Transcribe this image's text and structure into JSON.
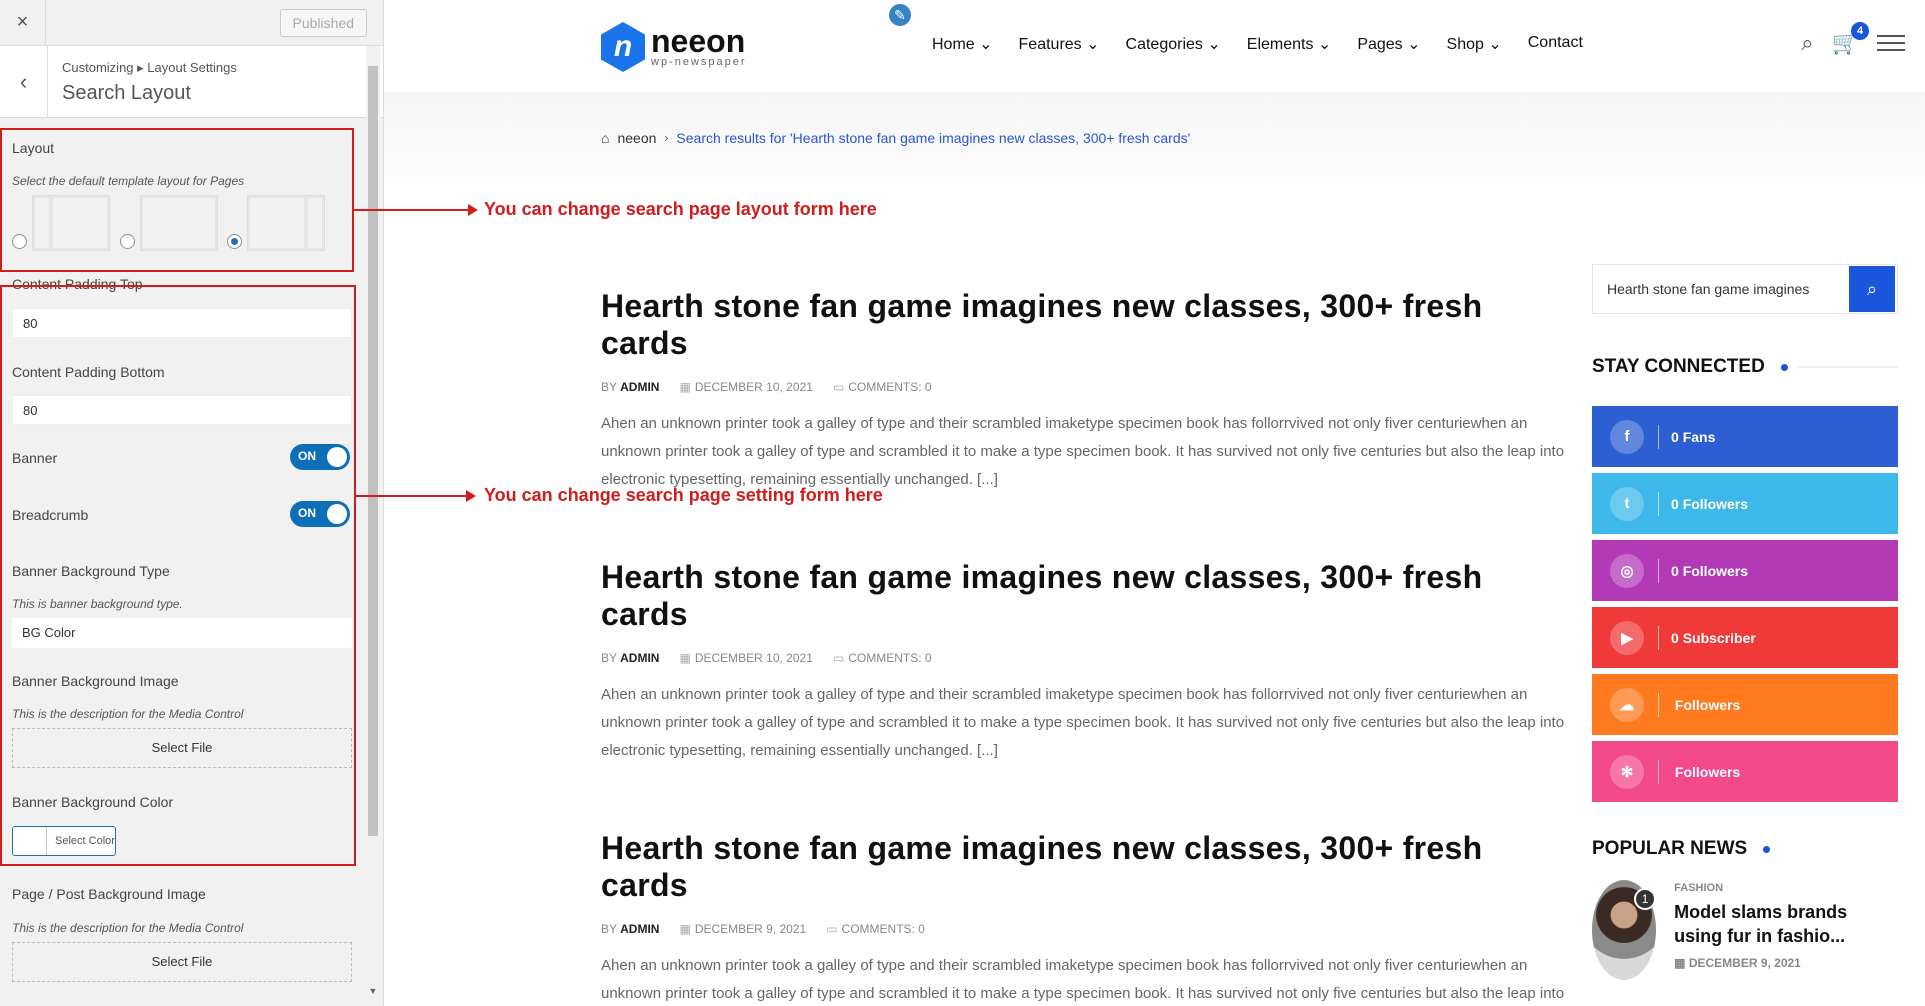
{
  "customizer": {
    "close_icon": "×",
    "published_label": "Published",
    "breadcrumb": "Customizing ▸ Layout Settings",
    "title": "Search Layout",
    "layout": {
      "label": "Layout",
      "description": "Select the default template layout for Pages",
      "selected": 3
    },
    "padding_top": {
      "label": "Content Padding Top",
      "value": "80"
    },
    "padding_bottom": {
      "label": "Content Padding Bottom",
      "value": "80"
    },
    "banner": {
      "label": "Banner",
      "toggle": "ON"
    },
    "breadcrumb_setting": {
      "label": "Breadcrumb",
      "toggle": "ON"
    },
    "banner_bg_type": {
      "label": "Banner Background Type",
      "description": "This is banner background type.",
      "value": "BG Color"
    },
    "banner_bg_image": {
      "label": "Banner Background Image",
      "description": "This is the description for the Media Control",
      "button": "Select File"
    },
    "banner_bg_color": {
      "label": "Banner Background Color",
      "button": "Select Color"
    },
    "page_bg_image": {
      "label": "Page / Post Background Image",
      "description": "This is the description for the Media Control",
      "button": "Select File"
    }
  },
  "annotations": {
    "layout_note": "You can change search page layout form here",
    "setting_note": "You can change search page setting form here"
  },
  "header": {
    "logo_name": "neeon",
    "logo_sub": "wp-newspaper",
    "nav": [
      "Home ⌄",
      "Features ⌄",
      "Categories ⌄",
      "Elements ⌄",
      "Pages ⌄",
      "Shop ⌄",
      "Contact"
    ],
    "cart_count": "4"
  },
  "breadcrumb": {
    "home": "neeon",
    "current": "Search results for 'Hearth stone fan game imagines new classes, 300+ fresh cards'"
  },
  "posts": [
    {
      "title": "Hearth stone fan game imagines new classes, 300+ fresh cards",
      "by": "BY",
      "author": "ADMIN",
      "date": "DECEMBER 10, 2021",
      "comments": "COMMENTS: 0",
      "excerpt": "Ahen an unknown printer took a galley of type and their scrambled imaketype specimen book has follorrvived not only fiver centuriewhen an unknown printer took a galley of type and scrambled it to make a type specimen book. It has survived not only five centuries but also the leap into electronic typesetting, remaining essentially unchanged. [...]"
    },
    {
      "title": "Hearth stone fan game imagines new classes, 300+ fresh cards",
      "by": "BY",
      "author": "ADMIN",
      "date": "DECEMBER 10, 2021",
      "comments": "COMMENTS: 0",
      "excerpt": "Ahen an unknown printer took a galley of type and their scrambled imaketype specimen book has follorrvived not only fiver centuriewhen an unknown printer took a galley of type and scrambled it to make a type specimen book. It has survived not only five centuries but also the leap into electronic typesetting, remaining essentially unchanged. [...]"
    },
    {
      "title": "Hearth stone fan game imagines new classes, 300+ fresh cards",
      "by": "BY",
      "author": "ADMIN",
      "date": "DECEMBER 9, 2021",
      "comments": "COMMENTS: 0",
      "excerpt": "Ahen an unknown printer took a galley of type and their scrambled imaketype specimen book has follorrvived not only fiver centuriewhen an unknown printer took a galley of type and scrambled it to make a type specimen book. It has survived not only five centuries but also the leap into electronic typesetting, remaining essentially unchanged. [...]"
    }
  ],
  "sidebar": {
    "search_value": "Hearth stone fan game imagines",
    "stay_connected": "STAY CONNECTED",
    "socials": [
      {
        "icon": "facebook-icon",
        "glyph": "f",
        "count": "0",
        "label": "Fans",
        "color": "#2d5fd3"
      },
      {
        "icon": "twitter-icon",
        "glyph": "t",
        "count": "0",
        "label": "Followers",
        "color": "#3db8e8"
      },
      {
        "icon": "instagram-icon",
        "glyph": "◎",
        "count": "0",
        "label": "Followers",
        "color": "#b33ab7"
      },
      {
        "icon": "youtube-icon",
        "glyph": "▶",
        "count": "0",
        "label": "Subscriber",
        "color": "#f03a3a"
      },
      {
        "icon": "soundcloud-icon",
        "glyph": "☁",
        "count": "",
        "label": "Followers",
        "color": "#ff7a1f"
      },
      {
        "icon": "dribbble-icon",
        "glyph": "✻",
        "count": "",
        "label": "Followers",
        "color": "#f2498a"
      }
    ],
    "popular_news": "POPULAR NEWS",
    "pop_item": {
      "num": "1",
      "category": "FASHION",
      "title": "Model slams brands using fur in fashio...",
      "date": "DECEMBER 9, 2021"
    }
  }
}
